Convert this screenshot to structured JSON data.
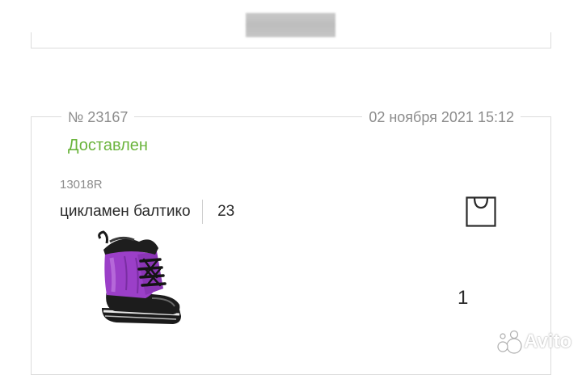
{
  "order": {
    "number": "№ 23167",
    "date": "02 ноября 2021 15:12",
    "status": "Доставлен",
    "status_color": "#6ab43c"
  },
  "item": {
    "article": "13018R",
    "color": "цикламен балтико",
    "size": "23",
    "quantity": "1",
    "image": "purple-winter-boot"
  },
  "icons": {
    "bag": "shopping-bag-icon"
  },
  "watermark": {
    "text": "Avito"
  }
}
